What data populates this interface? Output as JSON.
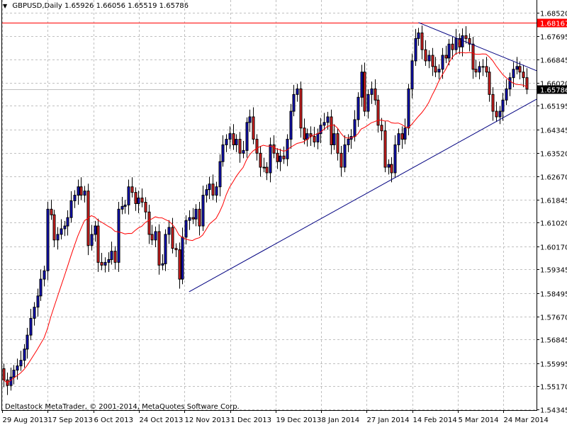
{
  "header": {
    "symbol_timeframe": "GBPUSD,Daily",
    "open": "1.65926",
    "high": "1.66056",
    "low": "1.65519",
    "close": "1.65786",
    "menu_icon": "triangle-down-icon"
  },
  "footer": {
    "copyright": "Deltastock MetaTrader, © 2001-2014, MetaQuotes Software Corp."
  },
  "colors": {
    "bull_body": "#1010c0",
    "bear_body": "#e02020",
    "wick": "#000000",
    "moving_average": "#ff0000",
    "trendline": "#000080",
    "horizontal_line": "#ff0000",
    "grid": "#c0c0c0",
    "bid_line": "#c0c0c0"
  },
  "chart_data": {
    "type": "candlestick",
    "symbol": "GBPUSD",
    "timeframe": "Daily",
    "grid": true,
    "ylim": [
      1.54345,
      1.6852
    ],
    "y_ticks": [
      "1.68520",
      "1.67695",
      "1.66845",
      "1.66020",
      "1.65195",
      "1.64345",
      "1.63520",
      "1.62670",
      "1.61845",
      "1.61020",
      "1.60170",
      "1.59345",
      "1.58495",
      "1.57670",
      "1.56845",
      "1.55995",
      "1.55170",
      "1.54345"
    ],
    "x_ticks": [
      "29 Aug 2013",
      "17 Sep 2013",
      "6 Oct 2013",
      "24 Oct 2013",
      "12 Nov 2013",
      "1 Dec 2013",
      "19 Dec 2013",
      "8 Jan 2014",
      "27 Jan 2014",
      "14 Feb 2014",
      "5 Mar 2014",
      "24 Mar 2014"
    ],
    "closes": [
      1.554,
      1.552,
      1.555,
      1.5575,
      1.559,
      1.561,
      1.565,
      1.57,
      1.576,
      1.58,
      1.584,
      1.59,
      1.593,
      1.615,
      1.613,
      1.604,
      1.606,
      1.608,
      1.609,
      1.612,
      1.618,
      1.62,
      1.623,
      1.62,
      1.6215,
      1.602,
      1.606,
      1.609,
      1.596,
      1.595,
      1.596,
      1.597,
      1.6,
      1.596,
      1.615,
      1.616,
      1.6165,
      1.623,
      1.621,
      1.617,
      1.619,
      1.6175,
      1.614,
      1.606,
      1.604,
      1.607,
      1.595,
      1.5955,
      1.606,
      1.6085,
      1.601,
      1.6005,
      1.59,
      1.605,
      1.611,
      1.612,
      1.6115,
      1.615,
      1.609,
      1.62,
      1.622,
      1.624,
      1.62,
      1.623,
      1.632,
      1.638,
      1.64,
      1.642,
      1.638,
      1.64,
      1.635,
      1.636,
      1.646,
      1.648,
      1.64,
      1.635,
      1.63,
      1.63,
      1.628,
      1.638,
      1.635,
      1.632,
      1.634,
      1.633,
      1.64,
      1.65,
      1.656,
      1.658,
      1.644,
      1.64,
      1.642,
      1.641,
      1.639,
      1.642,
      1.645,
      1.646,
      1.648,
      1.638,
      1.642,
      1.635,
      1.63,
      1.638,
      1.64,
      1.641,
      1.647,
      1.655,
      1.664,
      1.65,
      1.656,
      1.658,
      1.654,
      1.645,
      1.643,
      1.63,
      1.631,
      1.628,
      1.638,
      1.642,
      1.64,
      1.644,
      1.658,
      1.668,
      1.676,
      1.678,
      1.672,
      1.668,
      1.67,
      1.666,
      1.664,
      1.665,
      1.67,
      1.669,
      1.674,
      1.672,
      1.676,
      1.673,
      1.677,
      1.676,
      1.674,
      1.665,
      1.664,
      1.666,
      1.666,
      1.664,
      1.656,
      1.65,
      1.648,
      1.65,
      1.654,
      1.658,
      1.662,
      1.665,
      1.666,
      1.664,
      1.662,
      1.6579
    ],
    "first_open": 1.558,
    "current_price": {
      "label": "1.65786",
      "value": 1.65786
    },
    "horizontal_line": {
      "label": "1.68167",
      "value": 1.68167
    },
    "trendlines": [
      {
        "name": "resistance",
        "from": {
          "bar": 123,
          "price": 1.6817
        },
        "to": {
          "bar": 158,
          "price": 1.6645
        }
      },
      {
        "name": "support",
        "from": {
          "bar": 55,
          "price": 1.5855
        },
        "to": {
          "bar": 158,
          "price": 1.6543
        }
      }
    ],
    "indicator": "moving average"
  }
}
